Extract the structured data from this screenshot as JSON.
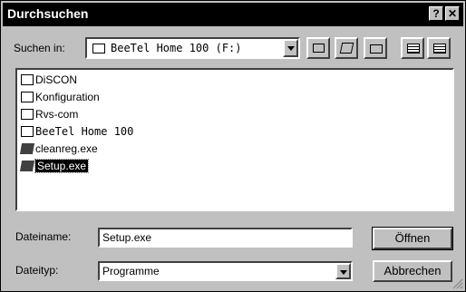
{
  "window": {
    "title": "Durchsuchen",
    "help": "?",
    "close": "✕"
  },
  "lookin": {
    "label": "Suchen in:",
    "value": "BeeTel Home 100 (F:)"
  },
  "files": [
    {
      "name": "DiSCON",
      "type": "folder",
      "mono": false
    },
    {
      "name": "Konfiguration",
      "type": "folder",
      "mono": false
    },
    {
      "name": "Rvs-com",
      "type": "folder",
      "mono": false
    },
    {
      "name": "BeeTel Home 100",
      "type": "folder",
      "mono": true
    },
    {
      "name": "cleanreg.exe",
      "type": "exe",
      "mono": false
    },
    {
      "name": "Setup.exe",
      "type": "exe",
      "mono": false,
      "selected": true
    }
  ],
  "filename": {
    "label": "Dateiname:",
    "value": "Setup.exe"
  },
  "filetype": {
    "label": "Dateityp:",
    "value": "Programme"
  },
  "buttons": {
    "open": "Öffnen",
    "cancel": "Abbrechen"
  }
}
